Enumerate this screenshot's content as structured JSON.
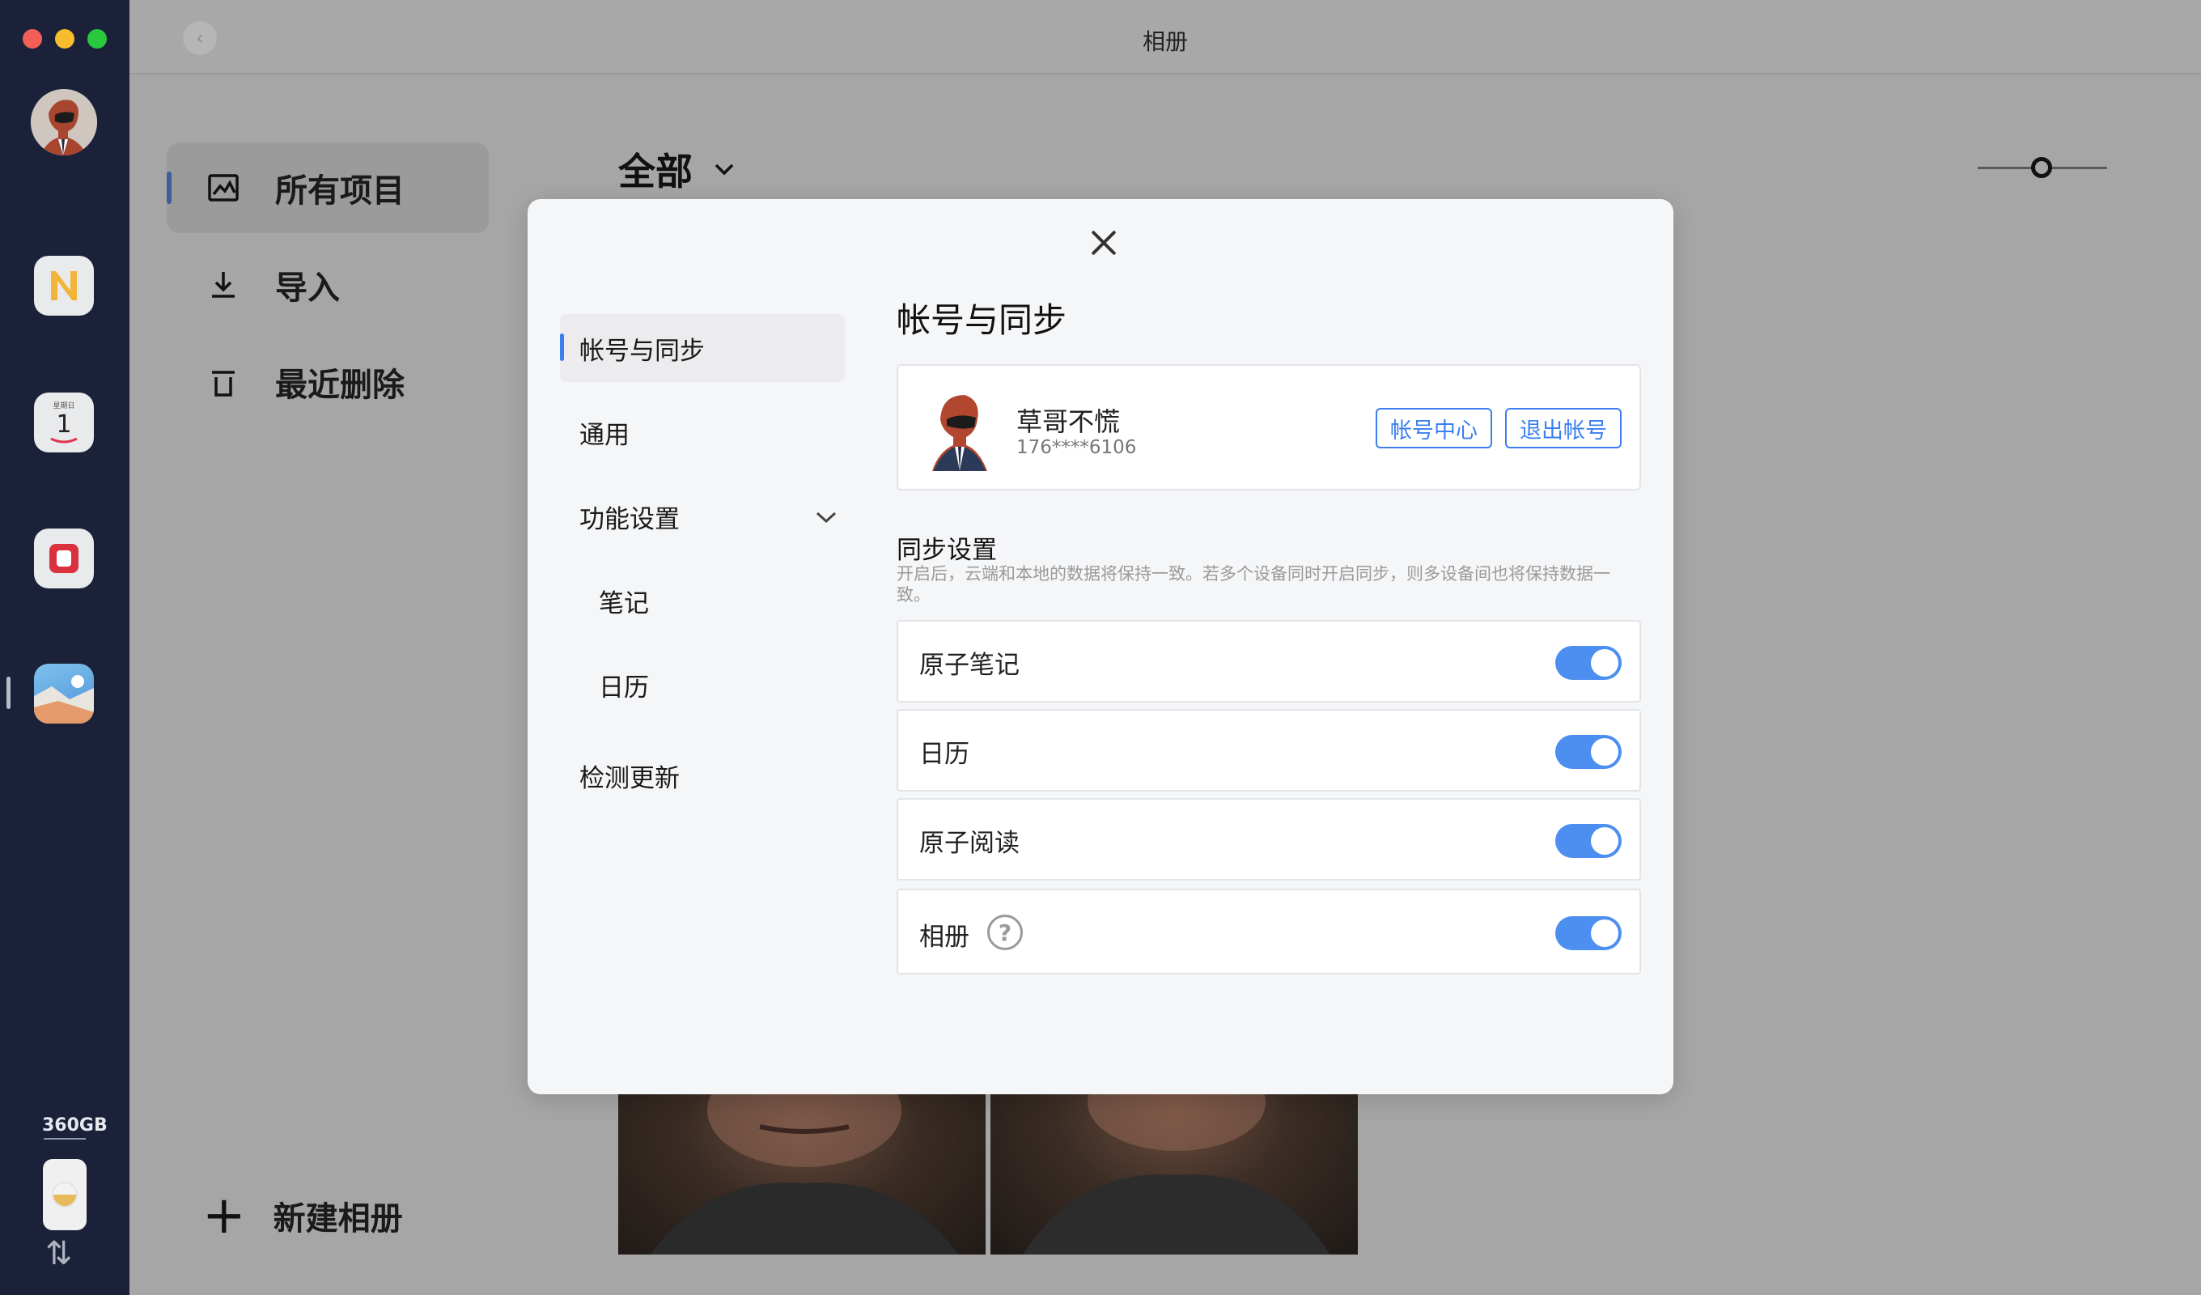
{
  "window": {
    "title": "相册"
  },
  "dock": {
    "storage": "360GB"
  },
  "sidebar": {
    "items": [
      {
        "label": "所有项目"
      },
      {
        "label": "导入"
      },
      {
        "label": "最近删除"
      }
    ],
    "new_album": "新建相册"
  },
  "main": {
    "filter_label": "全部"
  },
  "settings": {
    "nav": [
      {
        "label": "帐号与同步"
      },
      {
        "label": "通用"
      },
      {
        "label": "功能设置"
      },
      {
        "label": "笔记"
      },
      {
        "label": "日历"
      },
      {
        "label": "检测更新"
      }
    ],
    "title": "帐号与同步",
    "account": {
      "name": "草哥不慌",
      "phone": "176****6106",
      "center_button": "帐号中心",
      "logout_button": "退出帐号"
    },
    "sync": {
      "title": "同步设置",
      "description": "开启后，云端和本地的数据将保持一致。若多个设备同时开启同步，则多设备间也将保持数据一致。",
      "toggles": [
        {
          "label": "原子笔记",
          "enabled": true
        },
        {
          "label": "日历",
          "enabled": true
        },
        {
          "label": "原子阅读",
          "enabled": true
        },
        {
          "label": "相册",
          "enabled": true
        }
      ]
    }
  }
}
